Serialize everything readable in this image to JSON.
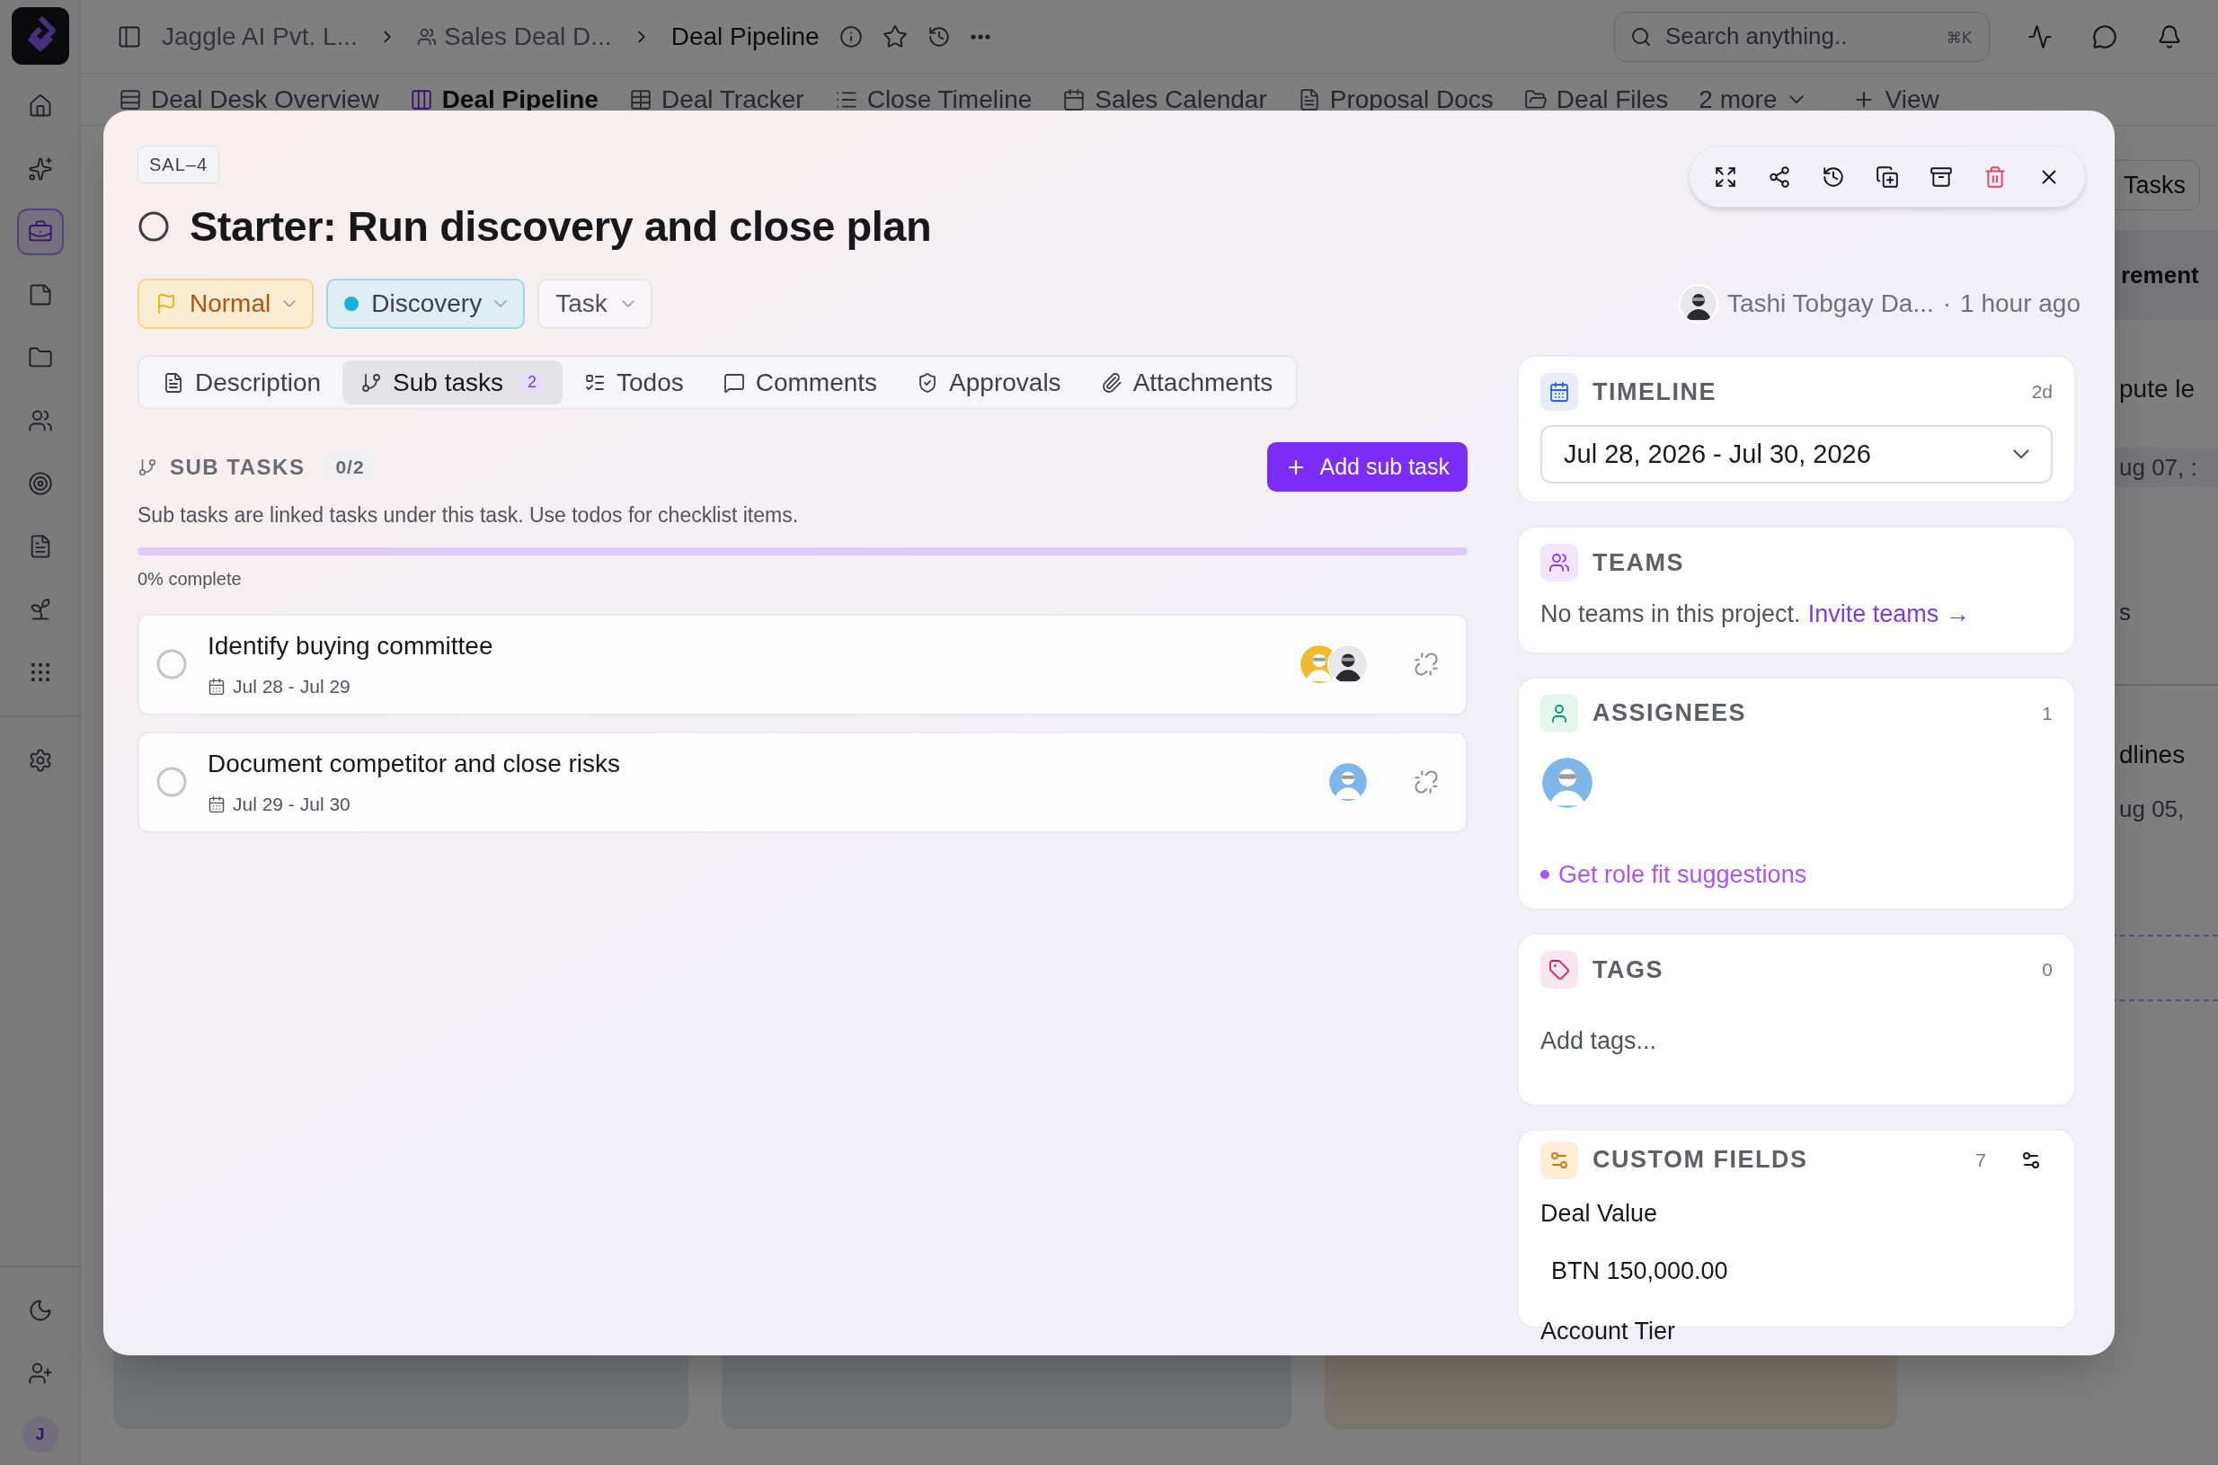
{
  "sidebar": {
    "nav": [
      {
        "selected": false
      },
      {
        "selected": false
      },
      {
        "selected": true
      },
      {
        "selected": false
      },
      {
        "selected": false
      },
      {
        "selected": false
      },
      {
        "selected": false
      },
      {
        "selected": false
      },
      {
        "selected": false
      },
      {
        "selected": false
      },
      {
        "selected": false
      }
    ],
    "user_initial": "J"
  },
  "breadcrumb": [
    {
      "label": "Jaggle AI Pvt. L...",
      "current": false
    },
    {
      "label": "Sales Deal D...",
      "current": false
    },
    {
      "label": "Deal Pipeline",
      "current": true
    }
  ],
  "search": {
    "placeholder": "Search anything..",
    "shortcut": "⌘K"
  },
  "views": [
    {
      "label": "Deal Desk Overview",
      "selected": false
    },
    {
      "label": "Deal Pipeline",
      "selected": true
    },
    {
      "label": "Deal Tracker",
      "selected": false
    },
    {
      "label": "Close Timeline",
      "selected": false
    },
    {
      "label": "Sales Calendar",
      "selected": false
    },
    {
      "label": "Proposal Docs",
      "selected": false
    },
    {
      "label": "Deal Files",
      "selected": false
    }
  ],
  "views_more": "2 more",
  "add_view": "View",
  "board_fragments": {
    "button": "Tasks",
    "card_title": "rement",
    "card_text": "pute le",
    "card_date": "ug 07, :",
    "card_2_text": "s",
    "card_3_title": "dlines",
    "card_3_date": "ug 05,"
  },
  "task": {
    "key": "SAL–4",
    "title": "Starter: Run discovery and close plan",
    "completed": false,
    "priority": "Normal",
    "status": "Discovery",
    "type": "Task",
    "creator": "Tashi Tobgay Da...",
    "separator": "·",
    "created": "1 hour ago"
  },
  "tabs": [
    {
      "label": "Description",
      "selected": false
    },
    {
      "label": "Sub tasks",
      "selected": true,
      "count": "2"
    },
    {
      "label": "Todos",
      "selected": false
    },
    {
      "label": "Comments",
      "selected": false
    },
    {
      "label": "Approvals",
      "selected": false
    },
    {
      "label": "Attachments",
      "selected": false
    }
  ],
  "subtasks": {
    "title": "SUB TASKS",
    "count": "0/2",
    "add_button": "Add sub task",
    "hint": "Sub tasks are linked tasks under this task. Use todos for checklist items.",
    "level": 0,
    "progress_label": "0% complete",
    "items": [
      {
        "title": "Identify buying committee",
        "dates": "Jul 28 - Jul 29",
        "completed": false
      },
      {
        "title": "Document competitor and close risks",
        "dates": "Jul 29 - Jul 30",
        "completed": false
      }
    ]
  },
  "timeline": {
    "title": "TIMELINE",
    "duration": "2d",
    "range": "Jul 28, 2026 - Jul 30, 2026"
  },
  "teams": {
    "title": "TEAMS",
    "empty_text": "No teams in this project.",
    "link": "Invite teams →"
  },
  "assignees": {
    "title": "ASSIGNEES",
    "count": "1",
    "suggestion": "Get role fit suggestions"
  },
  "tags": {
    "title": "TAGS",
    "count": "0",
    "placeholder": "Add tags..."
  },
  "custom_fields": {
    "title": "CUSTOM FIELDS",
    "count": "7",
    "fields": [
      {
        "label": "Deal Value",
        "value": "BTN 150,000.00"
      },
      {
        "label": "Account Tier"
      }
    ]
  }
}
